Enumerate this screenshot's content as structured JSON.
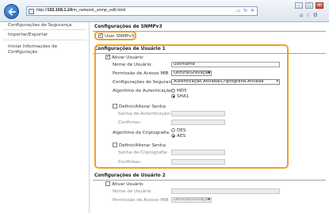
{
  "browser": {
    "url_prefix": "http://",
    "url_host": "192.168.1.24",
    "url_path": "/m_network_snmp_edit.html"
  },
  "sidebar": {
    "items": [
      {
        "label": "Configurações de Segurança"
      },
      {
        "label": "Importar/Exportar"
      },
      {
        "label": "Iniciar Informações de"
      },
      {
        "label": "Configuração"
      }
    ]
  },
  "snmpv3": {
    "title": "Configurações de SNMPv3",
    "use_label": "Usar SNMPv3"
  },
  "user1": {
    "title": "Configurações de Usuário 1",
    "enable_label": "Ativar Usuário",
    "username_label": "Nome de Usuário:",
    "username_value": "username",
    "mib_label": "Permissão de Acesso MIB",
    "mib_value": "Leitura/Gravação",
    "security_label": "Configurações de Segurança:",
    "security_value": "Autenticação Ativada/Criptografia Ativada",
    "auth_algo_label": "Algoritmo de Autenticação:",
    "auth_md5": "MD5",
    "auth_sha1": "SHA1",
    "set_pw_label": "Definir/Alterar Senha",
    "auth_pw_label": "Senha de Autenticação:",
    "confirm_label": "Confirmar:",
    "enc_algo_label": "Algoritmo de Criptografia:",
    "enc_des": "DES",
    "enc_aes": "AES",
    "set_pw2_label": "Definir/Alterar Senha",
    "enc_pw_label": "Senha de Criptografia:",
    "confirm2_label": "Confirmar:"
  },
  "user2": {
    "title": "Configurações de Usuário 2",
    "enable_label": "Ativar Usuário",
    "username_label": "Nome de Usuário:",
    "mib_label": "Permissão de Acesso MIB",
    "mib_value": "Leitura/Gravação"
  },
  "colors": {
    "highlight": "#f0a020",
    "back_button": "#1f5fb5"
  }
}
